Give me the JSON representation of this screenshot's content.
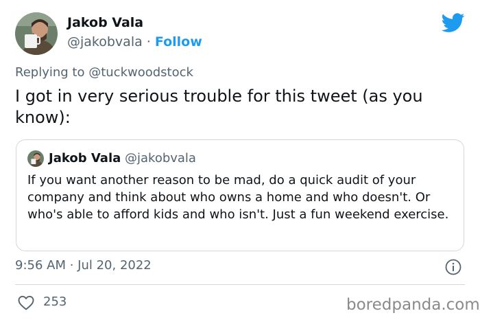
{
  "author": {
    "name": "Jakob Vala",
    "handle": "@jakobvala",
    "separator": " · ",
    "follow_label": "Follow"
  },
  "reply": {
    "prefix": "Replying to ",
    "handle": "@tuckwoodstock"
  },
  "tweet_text": "I got in very serious trouble for this tweet (as you know):",
  "quoted": {
    "name": "Jakob Vala",
    "handle": "@jakobvala",
    "text": "If you want another reason to be mad, do a quick audit of your company and think about who owns a home and who doesn't. Or who's able to afford kids and who isn't. Just a fun weekend exercise."
  },
  "timestamp": "9:56 AM · Jul 20, 2022",
  "likes": "253",
  "watermark": "boredpanda.com",
  "icons": {
    "brand": "twitter-bird-icon",
    "info": "info-icon",
    "like": "heart-icon"
  },
  "colors": {
    "brand_blue": "#1d9bf0",
    "text_primary": "#0f1419",
    "text_secondary": "#536471",
    "border": "#cfd9de"
  }
}
